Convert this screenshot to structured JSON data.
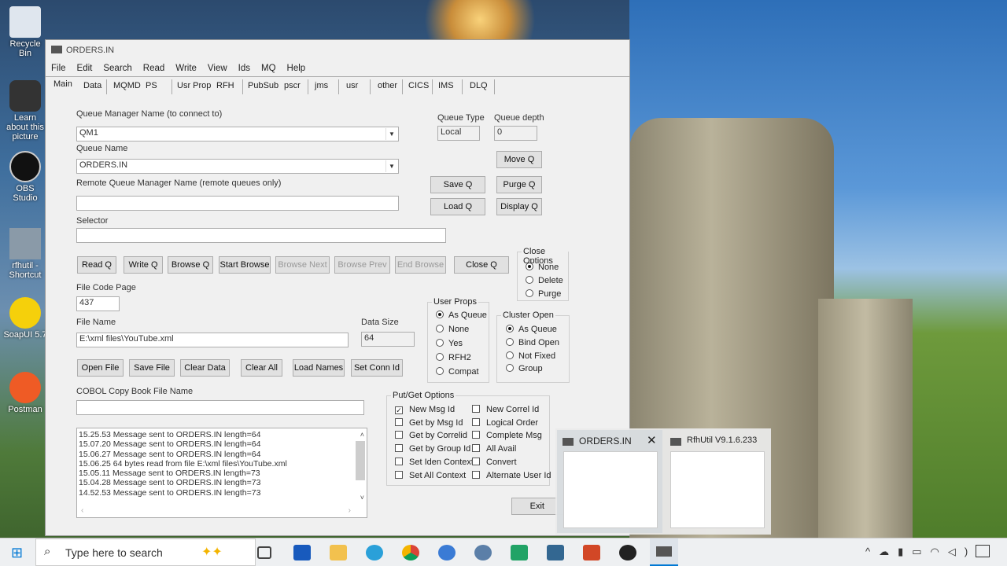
{
  "desktop": {
    "icons": [
      "Recycle Bin",
      "Learn about this picture",
      "OBS Studio",
      "rfhutil - Shortcut",
      "SoapUI 5.7",
      "Postman"
    ]
  },
  "window": {
    "title": "ORDERS.IN",
    "menu": [
      "File",
      "Edit",
      "Search",
      "Read",
      "Write",
      "View",
      "Ids",
      "MQ",
      "Help"
    ],
    "tabs": [
      "Main",
      "Data",
      "MQMD",
      "PS",
      "Usr Prop",
      "RFH",
      "PubSub",
      "pscr",
      "jms",
      "usr",
      "other",
      "CICS",
      "IMS",
      "DLQ"
    ],
    "qm_label": "Queue Manager Name (to connect to)",
    "qm_value": "QM1",
    "qname_label": "Queue Name",
    "qname_value": "ORDERS.IN",
    "remote_label": "Remote Queue Manager Name (remote queues only)",
    "remote_value": "",
    "selector_label": "Selector",
    "selector_value": "",
    "qtype_label": "Queue Type",
    "qtype_value": "Local",
    "qdepth_label": "Queue depth",
    "qdepth_value": "0",
    "qbuttons": {
      "move": "Move Q",
      "save": "Save Q",
      "purge": "Purge Q",
      "load": "Load Q",
      "display": "Display Q"
    },
    "actions": [
      "Read Q",
      "Write Q",
      "Browse Q",
      "Start Browse",
      "Browse Next",
      "Browse Prev",
      "End Browse",
      "Close Q"
    ],
    "close_options": {
      "title": "Close Options",
      "options": [
        "None",
        "Delete",
        "Purge"
      ],
      "selected": "None"
    },
    "codepage_label": "File Code Page",
    "codepage_value": "437",
    "filename_label": "File Name",
    "filename_value": "E:\\xml files\\YouTube.xml",
    "datasize_label": "Data Size",
    "datasize_value": "64",
    "user_props": {
      "title": "User Props",
      "options": [
        "As Queue",
        "None",
        "Yes",
        "RFH2",
        "Compat"
      ],
      "selected": "As Queue"
    },
    "cluster_open": {
      "title": "Cluster Open",
      "options": [
        "As Queue",
        "Bind Open",
        "Not Fixed",
        "Group"
      ],
      "selected": "As Queue"
    },
    "file_buttons": [
      "Open File",
      "Save File",
      "Clear Data",
      "Clear All",
      "Load Names",
      "Set Conn Id"
    ],
    "cobol_label": "COBOL Copy Book File Name",
    "cobol_value": "",
    "log": [
      "15.25.53 Message sent to ORDERS.IN length=64",
      "15.07.20 Message sent to ORDERS.IN length=64",
      "15.06.27 Message sent to ORDERS.IN length=64",
      "15.06.25 64 bytes read from file E:\\xml files\\YouTube.xml",
      "15.05.11 Message sent to ORDERS.IN length=73",
      "15.04.28 Message sent to ORDERS.IN length=73",
      "14.52.53 Message sent to ORDERS.IN length=73"
    ],
    "putget": {
      "title": "Put/Get Options",
      "left": [
        {
          "label": "New Msg Id",
          "checked": true
        },
        {
          "label": "Get by Msg Id",
          "checked": false
        },
        {
          "label": "Get by Correlid",
          "checked": false
        },
        {
          "label": "Get by Group Id",
          "checked": false
        },
        {
          "label": "Set Iden Context",
          "checked": false
        },
        {
          "label": "Set All Context",
          "checked": false
        }
      ],
      "right": [
        {
          "label": "New Correl Id",
          "checked": false
        },
        {
          "label": "Logical Order",
          "checked": false
        },
        {
          "label": "Complete Msg",
          "checked": false
        },
        {
          "label": "All Avail",
          "checked": false
        },
        {
          "label": "Convert",
          "checked": false
        },
        {
          "label": "Alternate User Id",
          "checked": false
        }
      ]
    },
    "exit": "Exit"
  },
  "popup": {
    "items": [
      {
        "title": "ORDERS.IN"
      },
      {
        "title": "RfhUtil V9.1.6.233"
      }
    ]
  },
  "taskbar": {
    "search_placeholder": "Type here to search"
  }
}
